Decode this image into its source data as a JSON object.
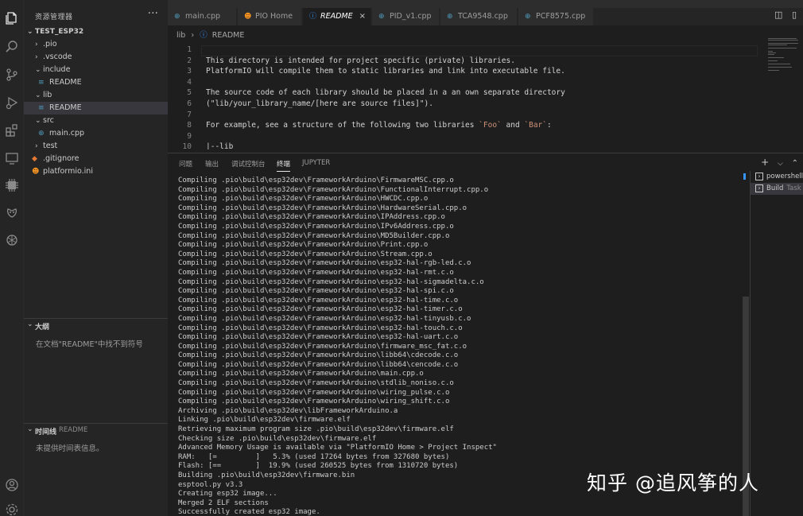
{
  "sidebar": {
    "header": "资源管理器",
    "more": "···",
    "project": "TEST_ESP32",
    "tree": [
      {
        "label": ".pio",
        "kind": "folder",
        "depth": 1
      },
      {
        "label": ".vscode",
        "kind": "folder",
        "depth": 1
      },
      {
        "label": "include",
        "kind": "folder-open",
        "depth": 1
      },
      {
        "label": "README",
        "kind": "readme",
        "depth": 2
      },
      {
        "label": "lib",
        "kind": "folder-open",
        "depth": 1
      },
      {
        "label": "README",
        "kind": "readme",
        "depth": 2,
        "selected": true
      },
      {
        "label": "src",
        "kind": "folder-open",
        "depth": 1
      },
      {
        "label": "main.cpp",
        "kind": "cpp",
        "depth": 2
      },
      {
        "label": "test",
        "kind": "folder",
        "depth": 1
      },
      {
        "label": ".gitignore",
        "kind": "git",
        "depth": 1
      },
      {
        "label": "platformio.ini",
        "kind": "pio",
        "depth": 1
      }
    ],
    "outline": {
      "title": "大纲",
      "message": "在文档\"README\"中找不到符号"
    },
    "timeline": {
      "title": "时间线",
      "subtitle": "README",
      "message": "未提供时间表信息。"
    }
  },
  "tabs": [
    {
      "label": "main.cpp",
      "icon": "cpp"
    },
    {
      "label": "PIO Home",
      "icon": "pio"
    },
    {
      "label": "README",
      "icon": "info",
      "active": true,
      "close": "×"
    },
    {
      "label": "PID_v1.cpp",
      "icon": "cpp"
    },
    {
      "label": "TCA9548.cpp",
      "icon": "cpp"
    },
    {
      "label": "PCF8575.cpp",
      "icon": "cpp"
    }
  ],
  "breadcrumb": {
    "folder": "lib",
    "file": "README",
    "sep": "›"
  },
  "editor": {
    "lines": [
      {
        "n": "1",
        "text": ""
      },
      {
        "n": "2",
        "text": "This directory is intended for project specific (private) libraries."
      },
      {
        "n": "3",
        "text": "PlatformIO will compile them to static libraries and link into executable file."
      },
      {
        "n": "4",
        "text": ""
      },
      {
        "n": "5",
        "text": "The source code of each library should be placed in a an own separate directory"
      },
      {
        "n": "6",
        "text": "(\"lib/your_library_name/[here are source files]\")."
      },
      {
        "n": "7",
        "text": ""
      },
      {
        "n": "8",
        "text": "For example, see a structure of the following two libraries `Foo` and `Bar`:"
      },
      {
        "n": "9",
        "text": ""
      },
      {
        "n": "10",
        "text": "|--lib"
      }
    ]
  },
  "panel": {
    "tabs": [
      "问题",
      "输出",
      "调试控制台",
      "终端",
      "JUPYTER"
    ],
    "active_tab": 3,
    "actions": {
      "add": "+",
      "split": "⌵",
      "maximize": "⌃"
    },
    "terminals": [
      {
        "label": "powershell",
        "sub": ""
      },
      {
        "label": "Build",
        "sub": "Task",
        "selected": true
      }
    ],
    "output": [
      "Compiling .pio\\build\\esp32dev\\FrameworkArduino\\FirmwareMSC.cpp.o",
      "Compiling .pio\\build\\esp32dev\\FrameworkArduino\\FunctionalInterrupt.cpp.o",
      "Compiling .pio\\build\\esp32dev\\FrameworkArduino\\HWCDC.cpp.o",
      "Compiling .pio\\build\\esp32dev\\FrameworkArduino\\HardwareSerial.cpp.o",
      "Compiling .pio\\build\\esp32dev\\FrameworkArduino\\IPAddress.cpp.o",
      "Compiling .pio\\build\\esp32dev\\FrameworkArduino\\IPv6Address.cpp.o",
      "Compiling .pio\\build\\esp32dev\\FrameworkArduino\\MD5Builder.cpp.o",
      "Compiling .pio\\build\\esp32dev\\FrameworkArduino\\Print.cpp.o",
      "Compiling .pio\\build\\esp32dev\\FrameworkArduino\\Stream.cpp.o",
      "Compiling .pio\\build\\esp32dev\\FrameworkArduino\\esp32-hal-rgb-led.c.o",
      "Compiling .pio\\build\\esp32dev\\FrameworkArduino\\esp32-hal-rmt.c.o",
      "Compiling .pio\\build\\esp32dev\\FrameworkArduino\\esp32-hal-sigmadelta.c.o",
      "Compiling .pio\\build\\esp32dev\\FrameworkArduino\\esp32-hal-spi.c.o",
      "Compiling .pio\\build\\esp32dev\\FrameworkArduino\\esp32-hal-time.c.o",
      "Compiling .pio\\build\\esp32dev\\FrameworkArduino\\esp32-hal-timer.c.o",
      "Compiling .pio\\build\\esp32dev\\FrameworkArduino\\esp32-hal-tinyusb.c.o",
      "Compiling .pio\\build\\esp32dev\\FrameworkArduino\\esp32-hal-touch.c.o",
      "Compiling .pio\\build\\esp32dev\\FrameworkArduino\\esp32-hal-uart.c.o",
      "Compiling .pio\\build\\esp32dev\\FrameworkArduino\\firmware_msc_fat.c.o",
      "Compiling .pio\\build\\esp32dev\\FrameworkArduino\\libb64\\cdecode.c.o",
      "Compiling .pio\\build\\esp32dev\\FrameworkArduino\\libb64\\cencode.c.o",
      "Compiling .pio\\build\\esp32dev\\FrameworkArduino\\main.cpp.o",
      "Compiling .pio\\build\\esp32dev\\FrameworkArduino\\stdlib_noniso.c.o",
      "Compiling .pio\\build\\esp32dev\\FrameworkArduino\\wiring_pulse.c.o",
      "Compiling .pio\\build\\esp32dev\\FrameworkArduino\\wiring_shift.c.o",
      "Archiving .pio\\build\\esp32dev\\libFrameworkArduino.a",
      "Linking .pio\\build\\esp32dev\\firmware.elf",
      "Retrieving maximum program size .pio\\build\\esp32dev\\firmware.elf",
      "Checking size .pio\\build\\esp32dev\\firmware.elf",
      "Advanced Memory Usage is available via \"PlatformIO Home > Project Inspect\"",
      "RAM:   [=         ]   5.3% (used 17264 bytes from 327680 bytes)",
      "Flash: [==        ]  19.9% (used 260525 bytes from 1310720 bytes)",
      "Building .pio\\build\\esp32dev\\firmware.bin",
      "esptool.py v3.3",
      "Creating esp32 image...",
      "Merged 2 ELF sections",
      "Successfully created esp32 image."
    ]
  },
  "watermark": "知乎 @追风筝的人"
}
